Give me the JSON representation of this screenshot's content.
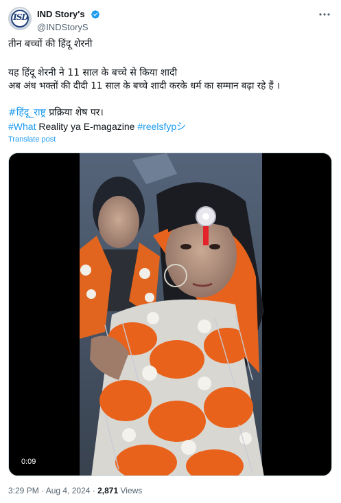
{
  "author": {
    "display_name": "IND Story's",
    "handle": "@INDStoryS",
    "avatar_monogram": "ISD",
    "verified_color": "#1d9bf0"
  },
  "icons": {
    "verified": "verified-badge-icon",
    "more": "more-options-icon"
  },
  "post": {
    "line1": "तीन बच्चों की हिंदू शेरनी",
    "line2": "यह हिंदू शेरनी ने 11 साल के बच्चे से किया शादी",
    "line3": "अब अंध भक्तों की दीदी 11 साल के बच्चे शादी करके धर्म का सम्मान बढ़ा रहे हैं ।",
    "hashtag1": "#हिंदू_राष्ट्र",
    "line4_rest": " प्रक्रिया शेष पर।",
    "hashtag2": "#What",
    "line5_mid": " Reality ya E-magazine ",
    "hashtag3": "#reelsfypシ",
    "translate_label": "Translate post"
  },
  "media": {
    "duration": "0:09"
  },
  "meta": {
    "time": "3:29 PM",
    "separator": " · ",
    "date": "Aug 4, 2024",
    "views_count": "2,871",
    "views_label": " Views"
  },
  "colors": {
    "link": "#1d9bf0",
    "secondary_text": "#536471",
    "primary_text": "#0f1419"
  }
}
